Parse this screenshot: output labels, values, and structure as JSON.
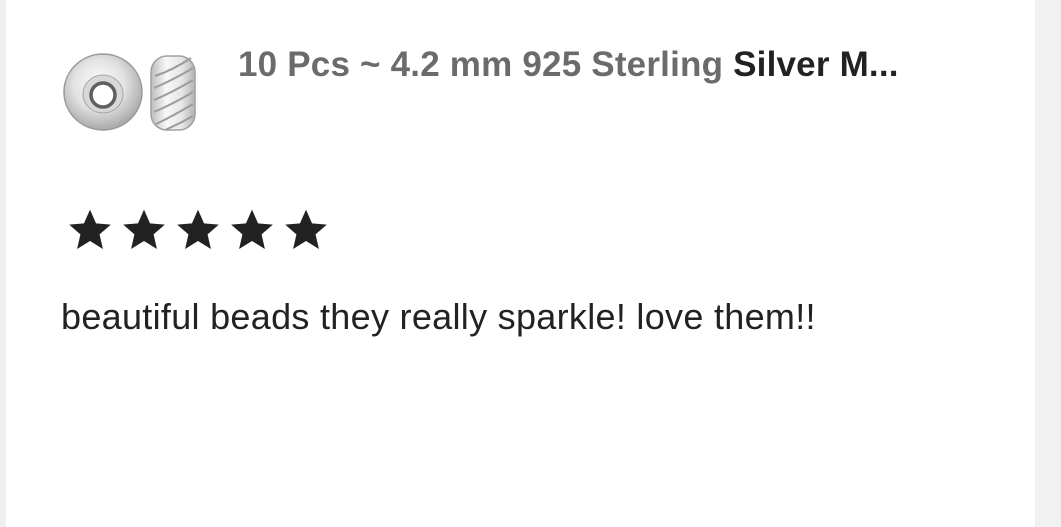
{
  "product": {
    "title_prefix": "10 Pcs ~ 4.2 mm 925 Sterling ",
    "title_suffix": "Silver M...",
    "thumbnail_icon": "silver-beads-thumbnail"
  },
  "review": {
    "rating": 5,
    "rating_max": 5,
    "text": "beautiful beads they really sparkle! love them!!"
  },
  "colors": {
    "star": "#222222",
    "text": "#222222",
    "muted_text": "#6b6b6b",
    "card_bg": "#ffffff",
    "page_bg": "#f3f3f3"
  }
}
